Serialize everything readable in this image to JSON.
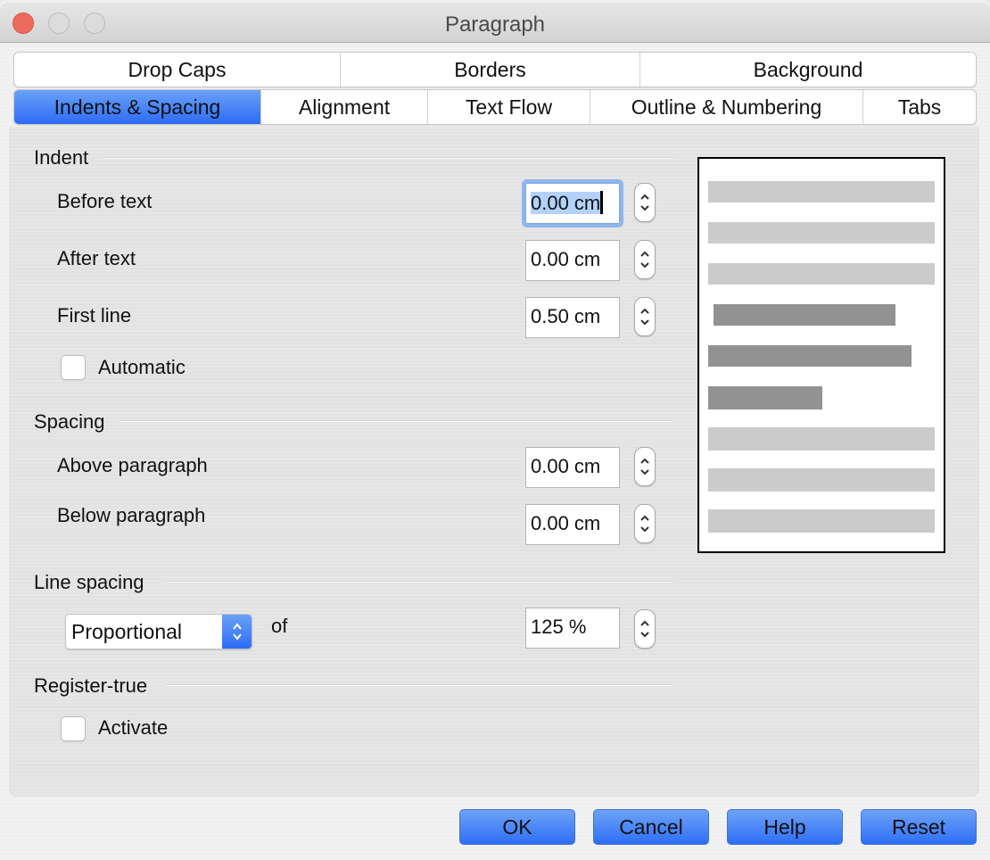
{
  "window": {
    "title": "Paragraph"
  },
  "tabs": {
    "row1": [
      {
        "label": "Drop Caps"
      },
      {
        "label": "Borders"
      },
      {
        "label": "Background"
      }
    ],
    "row2": [
      {
        "label": "Indents & Spacing",
        "active": true
      },
      {
        "label": "Alignment"
      },
      {
        "label": "Text Flow"
      },
      {
        "label": "Outline & Numbering"
      },
      {
        "label": "Tabs"
      }
    ]
  },
  "indent": {
    "heading": "Indent",
    "before_text": {
      "label": "Before text",
      "value": "0.00 cm"
    },
    "after_text": {
      "label": "After text",
      "value": "0.00 cm"
    },
    "first_line": {
      "label": "First line",
      "value": "0.50 cm"
    },
    "automatic": {
      "label": "Automatic",
      "checked": false
    }
  },
  "spacing": {
    "heading": "Spacing",
    "above": {
      "label": "Above paragraph",
      "value": "0.00 cm"
    },
    "below": {
      "label": "Below paragraph",
      "value": "0.00 cm"
    }
  },
  "line_spacing": {
    "heading": "Line spacing",
    "mode": "Proportional",
    "of_label": "of",
    "value": "125 %"
  },
  "register_true": {
    "heading": "Register-true",
    "activate": {
      "label": "Activate",
      "checked": false
    }
  },
  "preview": {
    "light_color": "#cbcbcb",
    "dark_color": "#929292"
  },
  "buttons": {
    "ok": "OK",
    "cancel": "Cancel",
    "help": "Help",
    "reset": "Reset"
  },
  "colors": {
    "accent": "#2c6cf5",
    "close_button": "#ed6a5e"
  }
}
